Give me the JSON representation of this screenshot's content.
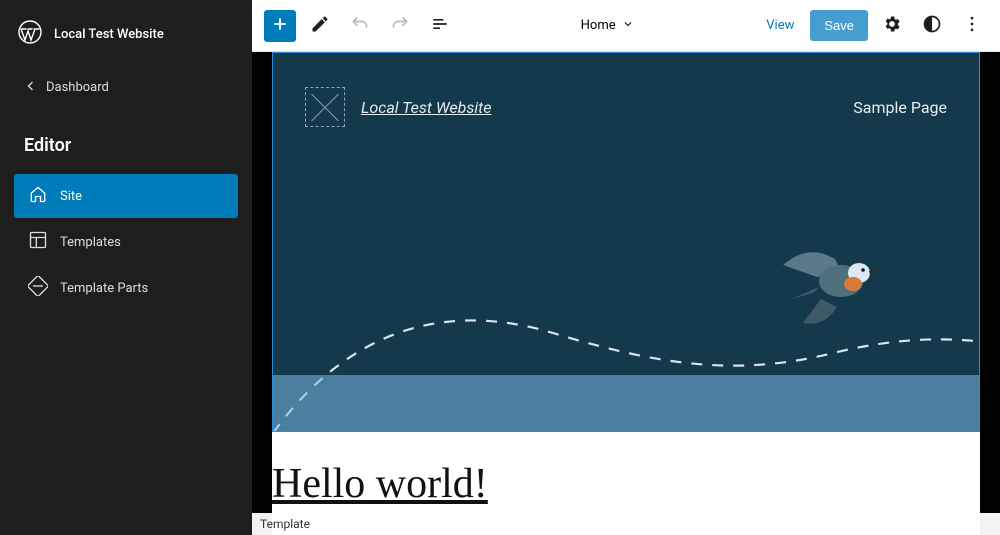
{
  "sidebar": {
    "site_name": "Local Test Website",
    "dashboard_label": "Dashboard",
    "editor_label": "Editor",
    "items": [
      {
        "label": "Site"
      },
      {
        "label": "Templates"
      },
      {
        "label": "Template Parts"
      }
    ]
  },
  "topbar": {
    "doc_title": "Home",
    "view_label": "View",
    "save_label": "Save"
  },
  "hero": {
    "site_title": "Local Test Website",
    "nav_item": "Sample Page"
  },
  "content": {
    "post_title": "Hello world!"
  },
  "statusbar": {
    "text": "Template"
  },
  "colors": {
    "accent": "#007cba",
    "sidebar_bg": "#1e1e1e",
    "hero_bg": "#13394b"
  }
}
